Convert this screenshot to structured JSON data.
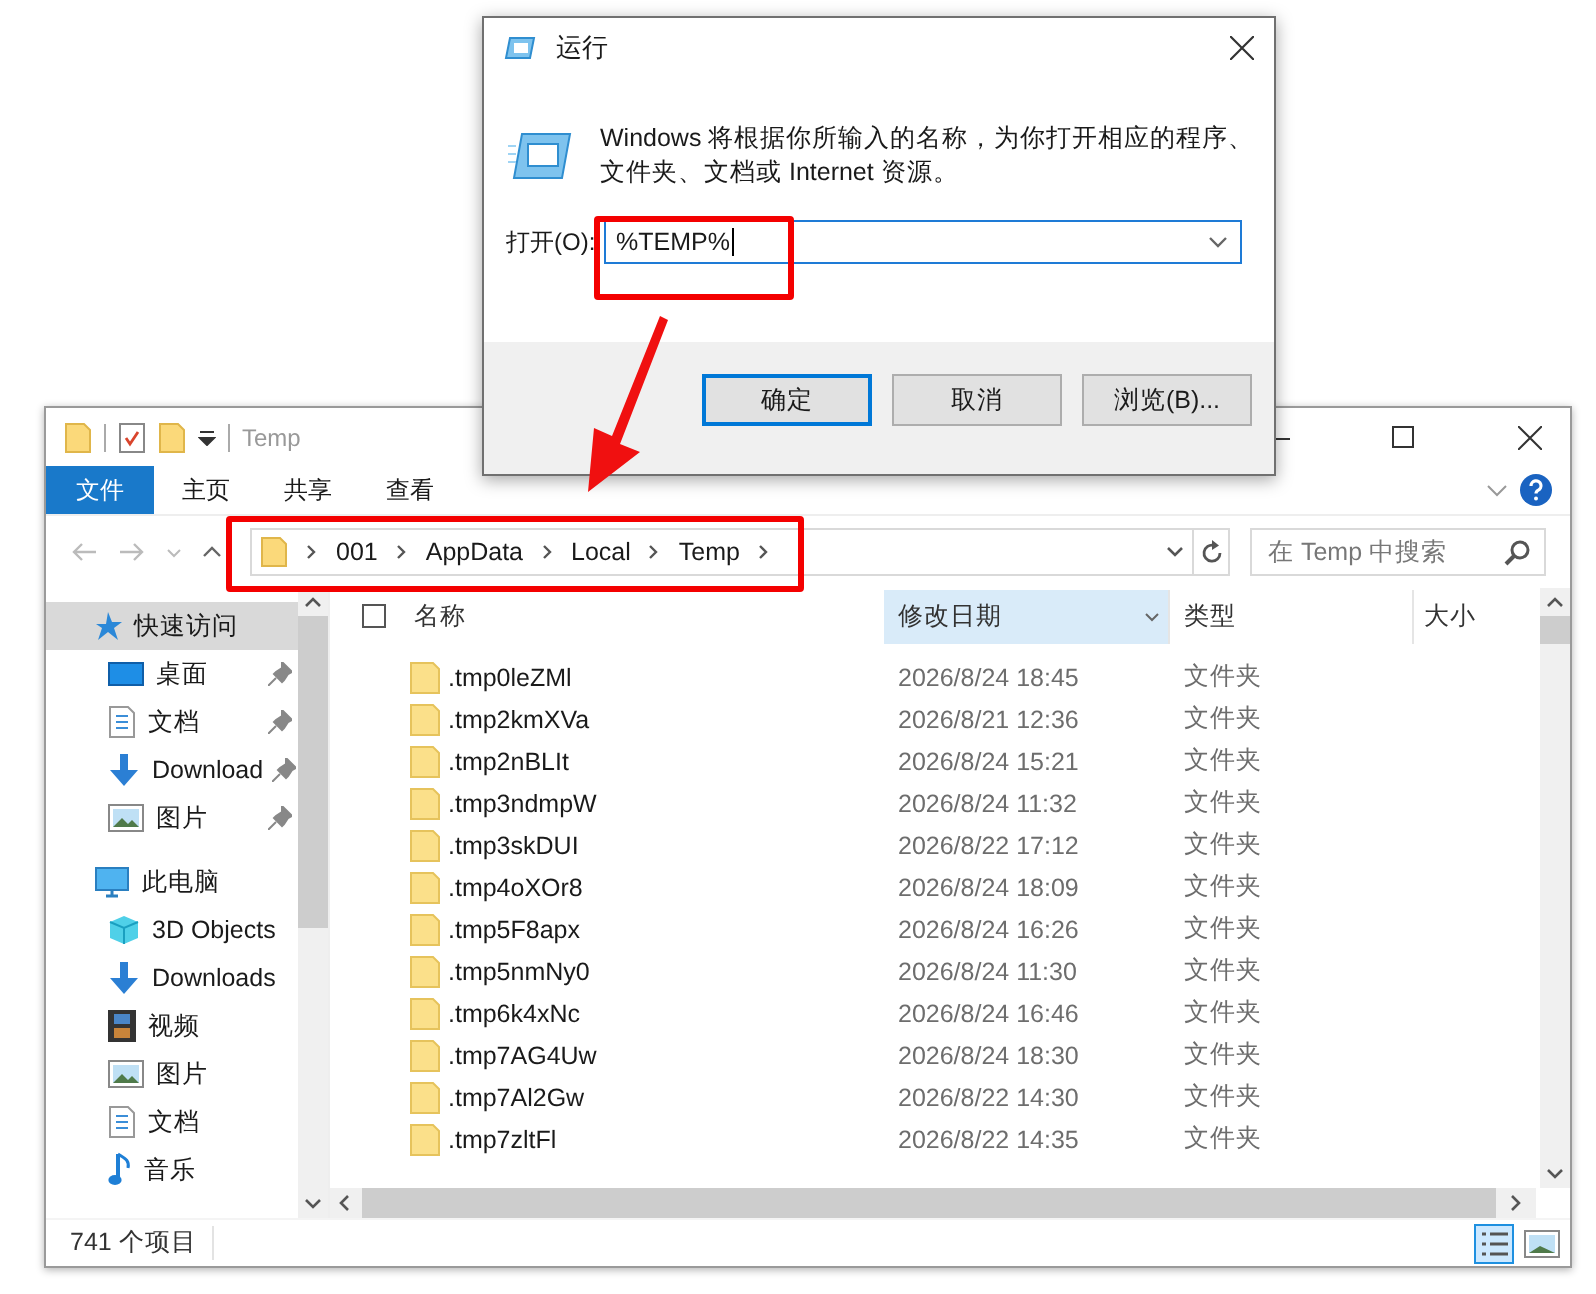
{
  "explorer": {
    "title": "Temp",
    "ribbon_tabs": [
      {
        "label": "文件",
        "selected": true
      },
      {
        "label": "主页",
        "selected": false
      },
      {
        "label": "共享",
        "selected": false
      },
      {
        "label": "查看",
        "selected": false
      }
    ],
    "address_path": [
      "001",
      "AppData",
      "Local",
      "Temp"
    ],
    "search": {
      "placeholder": "在 Temp 中搜索"
    },
    "sidebar": {
      "items": [
        {
          "label": "快速访问",
          "kind": "star",
          "selected": true,
          "children": [
            {
              "label": "桌面",
              "kind": "desktop",
              "pinned": true,
              "selected": false
            },
            {
              "label": "文档",
              "kind": "document",
              "pinned": true,
              "selected": false
            },
            {
              "label": "Download",
              "kind": "download",
              "pinned": true,
              "selected": false
            },
            {
              "label": "图片",
              "kind": "pictures",
              "pinned": true,
              "selected": false
            }
          ]
        },
        {
          "label": "此电脑",
          "kind": "computer",
          "selected": false,
          "children": [
            {
              "label": "3D Objects",
              "kind": "cube",
              "pinned": false,
              "selected": false
            },
            {
              "label": "Downloads",
              "kind": "download",
              "pinned": false,
              "selected": false
            },
            {
              "label": "视频",
              "kind": "video",
              "pinned": false,
              "selected": false
            },
            {
              "label": "图片",
              "kind": "pictures",
              "pinned": false,
              "selected": false
            },
            {
              "label": "文档",
              "kind": "document",
              "pinned": false,
              "selected": false
            },
            {
              "label": "音乐",
              "kind": "music",
              "pinned": false,
              "selected": false
            }
          ]
        }
      ]
    },
    "table": {
      "columns": [
        {
          "label": "名称",
          "sorted": false
        },
        {
          "label": "修改日期",
          "sorted": true
        },
        {
          "label": "类型",
          "sorted": false
        },
        {
          "label": "大小",
          "sorted": false
        }
      ],
      "rows": [
        {
          "name": ".tmp0leZMl",
          "modified": "2026/8/24 18:45",
          "type": "文件夹"
        },
        {
          "name": ".tmp2kmXVa",
          "modified": "2026/8/21 12:36",
          "type": "文件夹"
        },
        {
          "name": ".tmp2nBLIt",
          "modified": "2026/8/24 15:21",
          "type": "文件夹"
        },
        {
          "name": ".tmp3ndmpW",
          "modified": "2026/8/24 11:32",
          "type": "文件夹"
        },
        {
          "name": ".tmp3skDUI",
          "modified": "2026/8/22 17:12",
          "type": "文件夹"
        },
        {
          "name": ".tmp4oXOr8",
          "modified": "2026/8/24 18:09",
          "type": "文件夹"
        },
        {
          "name": ".tmp5F8apx",
          "modified": "2026/8/24 16:26",
          "type": "文件夹"
        },
        {
          "name": ".tmp5nmNy0",
          "modified": "2026/8/24 11:30",
          "type": "文件夹"
        },
        {
          "name": ".tmp6k4xNc",
          "modified": "2026/8/24 16:46",
          "type": "文件夹"
        },
        {
          "name": ".tmp7AG4Uw",
          "modified": "2026/8/24 18:30",
          "type": "文件夹"
        },
        {
          "name": ".tmp7Al2Gw",
          "modified": "2026/8/22 14:30",
          "type": "文件夹"
        },
        {
          "name": ".tmp7zltFl",
          "modified": "2026/8/22 14:35",
          "type": "文件夹"
        }
      ]
    },
    "select_all": {
      "checked": false
    },
    "status_bar": {
      "item_count": "741 个项目"
    }
  },
  "run_dialog": {
    "title": "运行",
    "message": [
      "Windows 将根据你所输入的名称，为你打开相应的程序、",
      "文件夹、文档或 Internet 资源。"
    ],
    "open_label": "打开(O):",
    "command": "%TEMP%",
    "buttons": [
      {
        "label": "确定",
        "default": true
      },
      {
        "label": "取消",
        "default": false
      },
      {
        "label": "浏览(B)...",
        "default": false
      }
    ]
  }
}
